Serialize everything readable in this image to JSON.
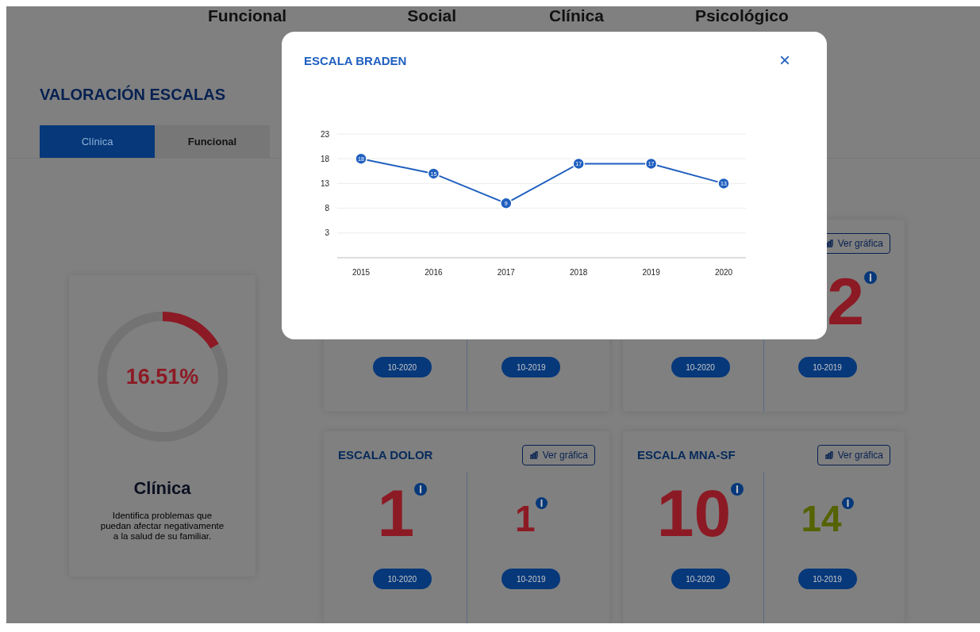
{
  "top_nav": [
    {
      "label": "Funcional"
    },
    {
      "label": "Social"
    },
    {
      "label": "Clínica"
    },
    {
      "label": "Psicológico"
    }
  ],
  "title": "VALORACIÓN ESCALAS",
  "tabs": [
    {
      "label": "Clínica",
      "selected": true
    },
    {
      "label": "Funcional",
      "selected": false
    }
  ],
  "summary": {
    "percent": "16.51%",
    "level": 0.1651,
    "title": "Clínica",
    "description": "Identifica problemas que puedan afectar negativamente a la salud de su familiar."
  },
  "cards": [
    {
      "values": [
        {
          "date": "10-2020"
        },
        {
          "date": "10-2019"
        }
      ]
    },
    {
      "button": "Ver gráfica",
      "values": [
        {
          "date": "10-2020"
        },
        {
          "text": "2",
          "kind": "primary",
          "color": "#8c1a24",
          "date": "10-2019"
        }
      ]
    },
    {
      "title": "ESCALA DOLOR",
      "button": "Ver gráfica",
      "values": [
        {
          "text": "1",
          "kind": "primary",
          "color": "#8c1a24",
          "date": "10-2020"
        },
        {
          "text": "1",
          "kind": "secondary",
          "color": "#8c1a24",
          "date": "10-2019"
        }
      ]
    },
    {
      "title": "ESCALA MNA-SF",
      "button": "Ver gráfica",
      "values": [
        {
          "text": "10",
          "kind": "primary",
          "color": "#8c1a24",
          "date": "10-2020"
        },
        {
          "text": "14",
          "kind": "secondary",
          "color": "#556300",
          "date": "10-2019"
        }
      ]
    }
  ],
  "modal": {
    "title": "ESCALA BRADEN",
    "close": "×",
    "chart_data": {
      "type": "line",
      "categories": [
        "2015",
        "2016",
        "2017",
        "2018",
        "2019",
        "2020"
      ],
      "series": [
        {
          "color": "#1f5fbf",
          "marker": "circle",
          "values": [
            18,
            15,
            9,
            17,
            17,
            13
          ]
        }
      ],
      "ylim": [
        -2,
        23
      ],
      "yticks": [
        3,
        8,
        13,
        18,
        23
      ],
      "grid": true,
      "data_labels": true
    }
  }
}
